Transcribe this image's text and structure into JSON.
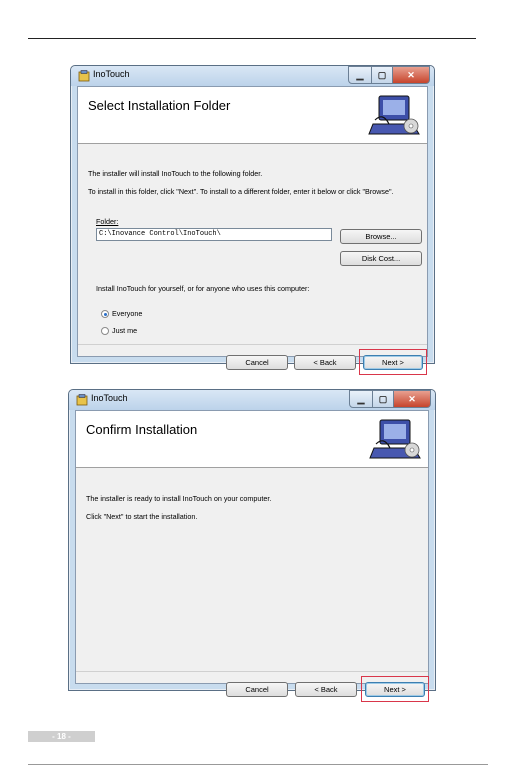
{
  "installer1": {
    "window_title": "InoTouch",
    "header_title": "Select Installation Folder",
    "intro": "The installer will install InoTouch to the following folder.",
    "instructions": "To install in this folder, click \"Next\". To install to a different folder, enter it below or click \"Browse\".",
    "folder_label": "Folder:",
    "folder_value": "C:\\Inovance Control\\InoTouch\\",
    "browse_label": "Browse...",
    "disk_cost_label": "Disk Cost...",
    "install_for_text": "Install InoTouch for yourself, or for anyone who uses this computer:",
    "radio_everyone_label": "Everyone",
    "radio_justme_label": "Just me",
    "selected_option": "Everyone",
    "cancel_label": "Cancel",
    "back_label": "< Back",
    "next_label": "Next >"
  },
  "installer2": {
    "window_title": "InoTouch",
    "header_title": "Confirm Installation",
    "ready_text": "The installer is ready to install InoTouch on your computer.",
    "click_next_text": "Click \"Next\" to start the installation.",
    "cancel_label": "Cancel",
    "back_label": "< Back",
    "next_label": "Next >"
  },
  "page": {
    "page_number": "- 18 -"
  },
  "colors": {
    "highlight": "#d9364a",
    "radio_selected": "#2a6fc9"
  },
  "icons": {
    "title": "installer-app-icon",
    "header": "computer-cd-icon",
    "minimize": "minimize-icon",
    "maximize": "maximize-icon",
    "close": "close-icon"
  }
}
